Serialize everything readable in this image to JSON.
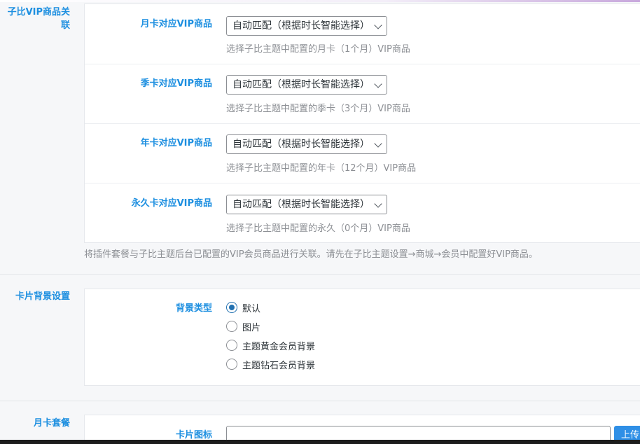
{
  "sections": {
    "vip_link_label": "子比VIP商品关联",
    "card_bg_label": "卡片背景设置",
    "monthly_plan_label": "月卡套餐"
  },
  "vip_fields": [
    {
      "label": "月卡对应VIP商品",
      "value": "自动匹配（根据时长智能选择）",
      "help": "选择子比主题中配置的月卡（1个月）VIP商品"
    },
    {
      "label": "季卡对应VIP商品",
      "value": "自动匹配（根据时长智能选择）",
      "help": "选择子比主题中配置的季卡（3个月）VIP商品"
    },
    {
      "label": "年卡对应VIP商品",
      "value": "自动匹配（根据时长智能选择）",
      "help": "选择子比主题中配置的年卡（12个月）VIP商品"
    },
    {
      "label": "永久卡对应VIP商品",
      "value": "自动匹配（根据时长智能选择）",
      "help": "选择子比主题中配置的永久（0个月）VIP商品"
    }
  ],
  "vip_note": "将插件套餐与子比主题后台已配置的VIP会员商品进行关联。请先在子比主题设置→商城→会员中配置好VIP商品。",
  "background": {
    "field_label": "背景类型",
    "options": [
      "默认",
      "图片",
      "主题黄金会员背景",
      "主题钻石会员背景"
    ],
    "selected_index": 0
  },
  "monthly": {
    "icon_label": "卡片图标",
    "icon_value": "",
    "upload_label": "上传"
  },
  "colors": {
    "accent": "#1d8fe0",
    "radio_checked": "#2271b1",
    "upload_button": "#2f8fe6"
  }
}
